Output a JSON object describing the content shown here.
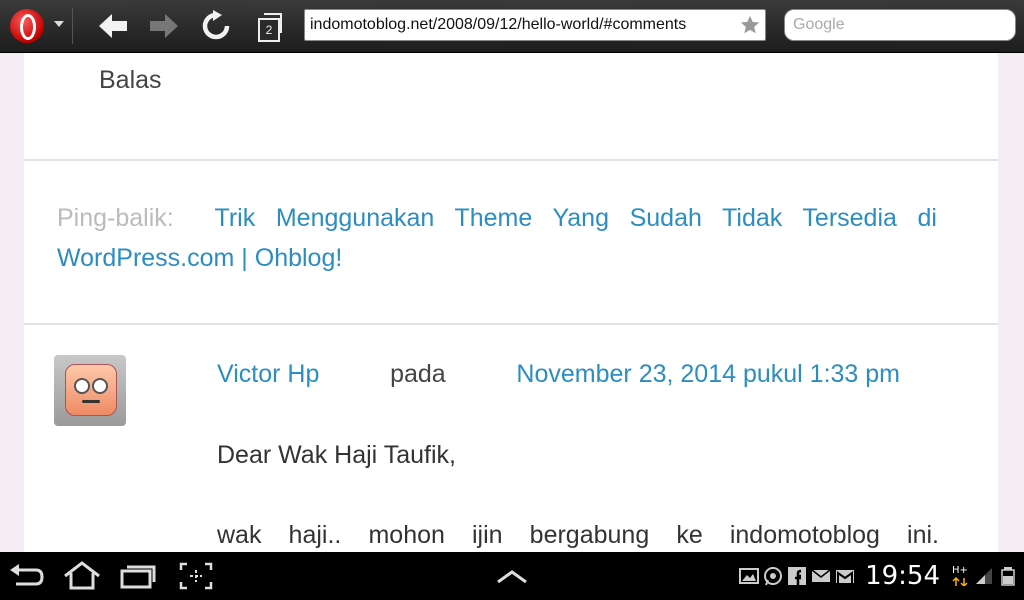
{
  "browser": {
    "tab_count": "2",
    "url": "indomotoblog.net/2008/09/12/hello-world/#comments",
    "search_placeholder": "Google"
  },
  "page": {
    "reply_label": "Balas",
    "pingback": {
      "label": "Ping-balik:",
      "link_text": "Trik Menggunakan Theme Yang Sudah Tidak Tersedia di WordPress.com | Ohblog!"
    },
    "comment": {
      "author": "Victor Hp",
      "on_word": "pada",
      "date": "November 23, 2014 pukul 1:33 pm",
      "paragraphs": [
        "Dear Wak Haji Taufik,",
        "wak haji.. mohon ijin bergabung ke indomotoblog ini."
      ]
    }
  },
  "system_bar": {
    "time": "19:54",
    "network": "H+"
  }
}
